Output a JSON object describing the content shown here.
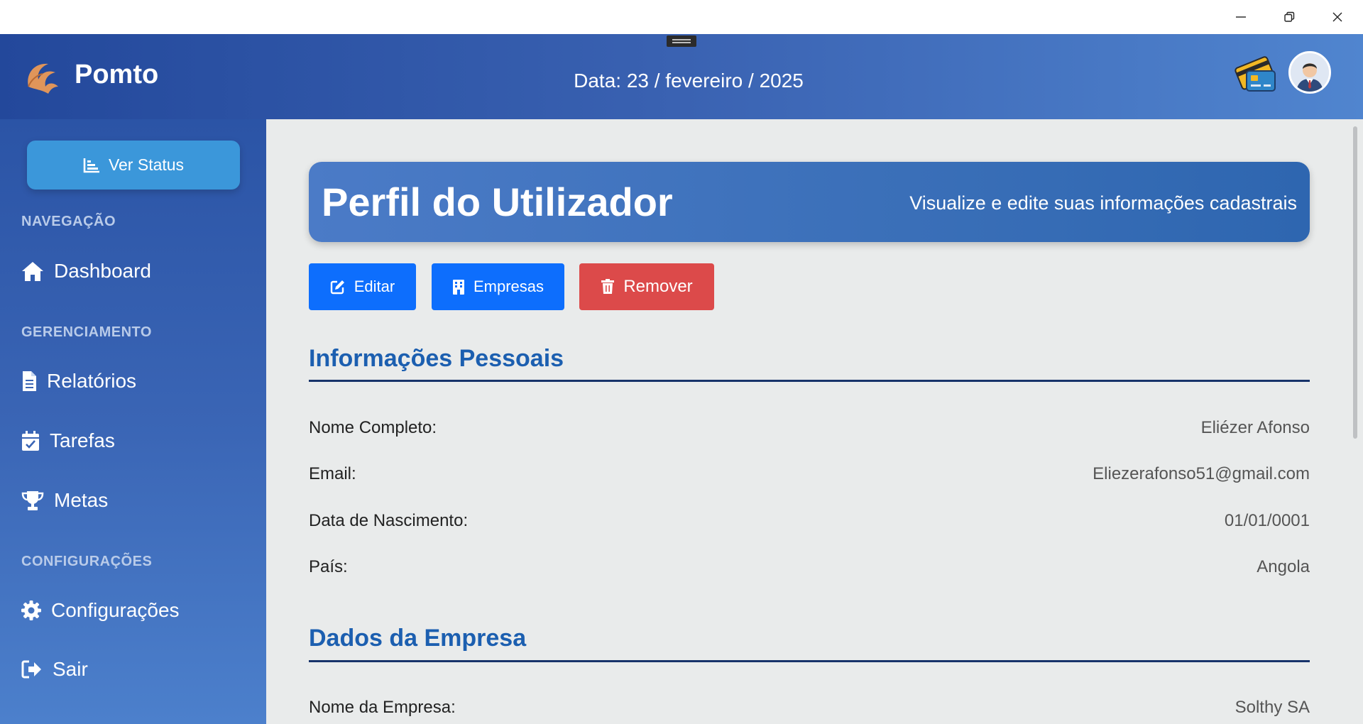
{
  "header": {
    "brand": "Pomto",
    "date": "Data: 23 / fevereiro / 2025"
  },
  "sidebar": {
    "status_button": "Ver Status",
    "sections": {
      "navigation": "NAVEGAÇÃO",
      "management": "GERENCIAMENTO",
      "settings": "CONFIGURAÇÕES"
    },
    "items": {
      "dashboard": "Dashboard",
      "reports": "Relatórios",
      "tasks": "Tarefas",
      "goals": "Metas",
      "settings": "Configurações",
      "logout": "Sair"
    }
  },
  "main": {
    "banner_title": "Perfil do Utilizador",
    "banner_subtitle": "Visualize e edite suas informações cadastrais",
    "buttons": {
      "edit": "Editar",
      "companies": "Empresas",
      "remove": "Remover"
    },
    "personal": {
      "title": "Informações Pessoais",
      "rows": [
        {
          "label": "Nome Completo:",
          "value": "Eliézer Afonso"
        },
        {
          "label": "Email:",
          "value": "Eliezerafonso51@gmail.com"
        },
        {
          "label": "Data de Nascimento:",
          "value": "01/01/0001"
        },
        {
          "label": "País:",
          "value": "Angola"
        }
      ]
    },
    "company": {
      "title": "Dados da Empresa",
      "rows": [
        {
          "label": "Nome da Empresa:",
          "value": "Solthy SA"
        }
      ]
    }
  },
  "colors": {
    "primary": "#0d6efd",
    "danger": "#dc4a4a",
    "section_title": "#1c5fb0"
  }
}
